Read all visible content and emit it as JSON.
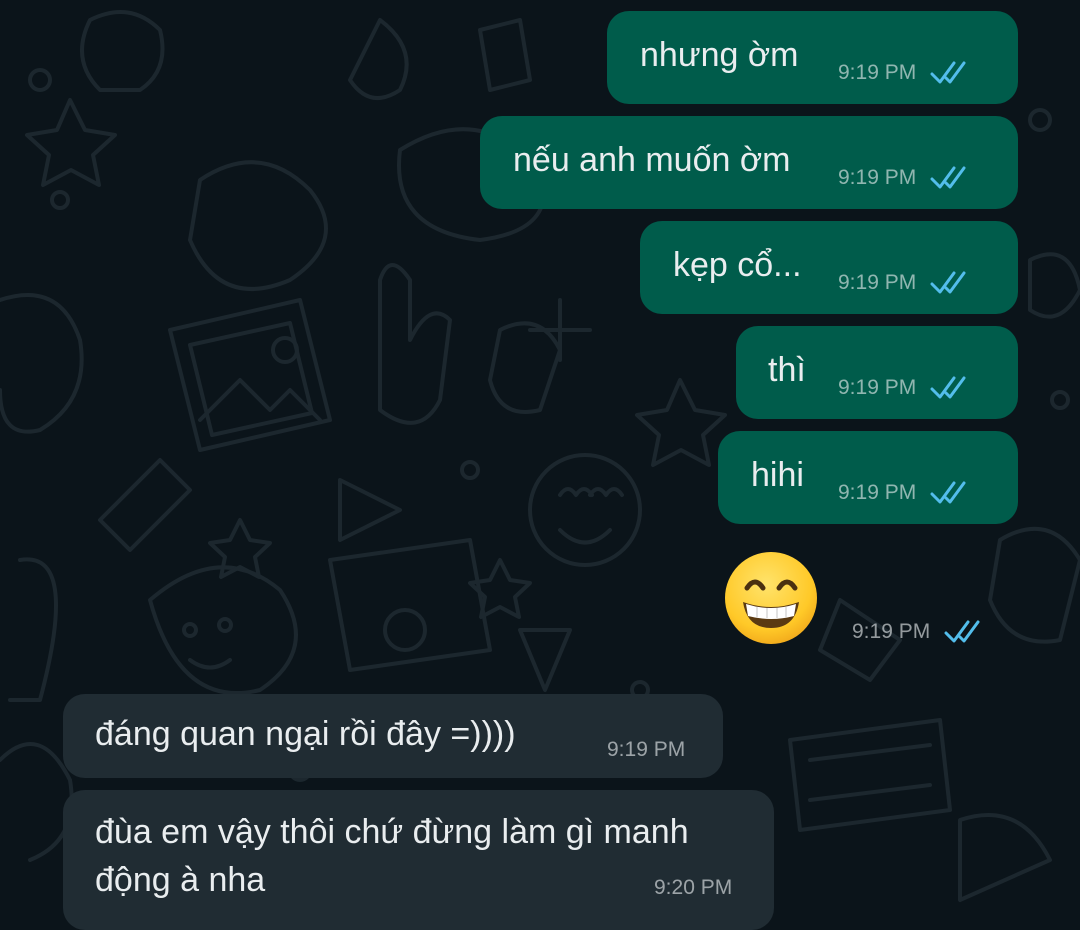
{
  "chat": {
    "messages": [
      {
        "direction": "outgoing",
        "text": "nhưng ờm",
        "time": "9:19 PM",
        "status": "read"
      },
      {
        "direction": "outgoing",
        "text": "nếu anh muốn ờm",
        "time": "9:19 PM",
        "status": "read"
      },
      {
        "direction": "outgoing",
        "text": "kẹp cổ...",
        "time": "9:19 PM",
        "status": "read"
      },
      {
        "direction": "outgoing",
        "text": "thì",
        "time": "9:19 PM",
        "status": "read"
      },
      {
        "direction": "outgoing",
        "text": "hihi",
        "time": "9:19 PM",
        "status": "read"
      },
      {
        "direction": "outgoing",
        "text": "",
        "emoji": "beaming-face-with-smiling-eyes",
        "time": "9:19 PM",
        "status": "read"
      },
      {
        "direction": "incoming",
        "text": "đáng quan ngại rồi đây =))))",
        "time": "9:19 PM"
      },
      {
        "direction": "incoming",
        "text": "đùa em vậy thôi chứ đừng làm gì manh động à nha",
        "time": "9:20 PM"
      }
    ]
  },
  "colors": {
    "background": "#0b141a",
    "outgoing_bubble": "#005c4b",
    "incoming_bubble": "#202c33",
    "text": "#e9edef",
    "read_ticks": "#53bdeb",
    "doodle": "#1c272e"
  },
  "icons": {
    "read_receipt": "double-check-icon",
    "emoji": "grinning-face-emoji"
  }
}
